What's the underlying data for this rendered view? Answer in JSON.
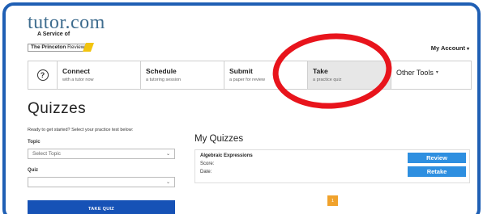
{
  "logo": {
    "word": "tutor.com",
    "subtitle": "A Service of",
    "partner_bold": "The Princeton",
    "partner_rest": " Review"
  },
  "header": {
    "account_label": "My Account"
  },
  "nav": {
    "items": [
      {
        "title": "Connect",
        "subtitle": "with a tutor now"
      },
      {
        "title": "Schedule",
        "subtitle": "a tutoring session"
      },
      {
        "title": "Submit",
        "subtitle": "a paper for review"
      },
      {
        "title": "Take",
        "subtitle": "a practice quiz"
      }
    ],
    "other_tools_label": "Other Tools"
  },
  "page": {
    "title": "Quizzes",
    "prompt": "Ready to get started? Select your practice test below:",
    "topic_label": "Topic",
    "topic_value": "Select Topic",
    "quiz_label": "Quiz",
    "quiz_value": "",
    "take_quiz_label": "TAKE QUIZ"
  },
  "my_quizzes": {
    "heading": "My Quizzes",
    "items": [
      {
        "name": "Algebraic Expressions",
        "score_label": "Score:",
        "date_label": "Date:",
        "review_label": "Review",
        "retake_label": "Retake"
      }
    ],
    "current_page": "1"
  },
  "colors": {
    "frame": "#1f5fb4",
    "take_quiz_button": "#1652b6",
    "action_buttons": "#2e8fe0",
    "pager": "#f0a22c",
    "annotation": "#e8141c",
    "active_tab": "#e7e7e7"
  }
}
